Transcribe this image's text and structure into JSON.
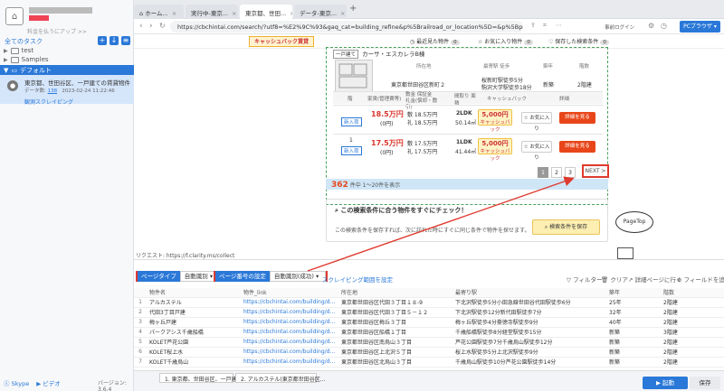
{
  "sidebar": {
    "account_sub": "料金を払うにアップ >>",
    "task_title": "全てのタスク",
    "folders": [
      {
        "label": "test"
      },
      {
        "label": "Samples"
      }
    ],
    "default_label": "デフォルト",
    "task": {
      "name": "東京都、世田谷区、一戸建ての賃貸物件（...",
      "data_label": "データ数:",
      "data_count": "138",
      "time": "2023-02-24 11:22:46",
      "link": "観測スクレイピング"
    },
    "footer": {
      "skype": "Skype",
      "video": "ビデオ",
      "version": "バージョン: 3.6.4"
    }
  },
  "browser": {
    "tabs": [
      {
        "label": "ホーム..."
      },
      {
        "label": "実行中-東京..."
      },
      {
        "label": "東京都、世田..."
      },
      {
        "label": "データ-東京..."
      }
    ],
    "url": "https://cbchintai.com/search/?utf8=%E2%9C%93&gaq_cat=building_refine&p%5Brailroad_or_location%5D=&p%5Bper_page%5D=&p%5Bsorts%5D=%5Bwith_ph",
    "login": "事前ログイン",
    "pc_button": "PCブラウザ"
  },
  "site": {
    "logo": "キャッシュバック賃貸",
    "nav": [
      {
        "label": "最近見た物件",
        "count": "0"
      },
      {
        "label": "お気に入り物件",
        "count": "0"
      },
      {
        "label": "保存した検索条件",
        "count": "0"
      }
    ],
    "building": {
      "tag": "一戸建て",
      "name": "カーサ・エスカレラB棟",
      "headers": [
        "所在地",
        "最寄駅 徒歩",
        "築年",
        "階数"
      ],
      "address": "東京都世田谷区新町２",
      "station1": "桜新町駅徒歩5分",
      "station2": "駒沢大学駅徒歩18分",
      "age": "新築",
      "floors": "2階建"
    },
    "room_headers": [
      "階",
      "家賃(管理費等)",
      "敷金 保証金\n礼金(償却・敷引)",
      "間取り 面積",
      "キャッシュバック",
      "詳細"
    ],
    "rooms": [
      {
        "floor": "",
        "tag": "新入荷",
        "rent": "18.5万円",
        "fee": "(0円)",
        "deposit": "敷 18.5万円",
        "key": "礼 18.5万円",
        "layout": "2LDK",
        "area": "50.14㎡",
        "cb": "5,000円",
        "fav": "☆ お気に入り",
        "detail": "詳細を見る"
      },
      {
        "floor": "1",
        "tag": "新入荷",
        "rent": "17.5万円",
        "fee": "(0円)",
        "deposit": "敷 17.5万円",
        "key": "礼 17.5万円",
        "layout": "1LDK",
        "area": "41.44㎡",
        "cb": "5,000円",
        "fav": "☆ お気に入り",
        "detail": "詳細を見る"
      }
    ],
    "cb_sub": "キャッシュバック",
    "pages": [
      "1",
      "2",
      "3"
    ],
    "next": "NEXT >",
    "count_num": "362",
    "count_text": "件中 1〜20件を表示",
    "save_title": "この検索条件に合う物件をすぐにチェック！",
    "save_sub": "この検索条件を保存すれば、次に訪れた時にすぐに同じ条件で物件を探せます。",
    "save_btn": "検索条件を保存",
    "pagetop": "PageTop"
  },
  "request": "リクエスト: https://f.clarity.ms/collect",
  "collapse": "折る",
  "toolbar": {
    "page_type_label": "ページタイプ",
    "page_type_value": "自動識別",
    "page_num_label": "ページ番号の設定",
    "page_num_value": "自動識別(成功)",
    "scrape_link": "スクレイピング範囲を設定",
    "filter": "フィルター",
    "clear": "クリア",
    "detail": "詳細ページに行く",
    "add_field": "フィールドを追加"
  },
  "table": {
    "headers": [
      "",
      "物件名",
      "物件_link",
      "所在地",
      "最寄り駅",
      "築年",
      "階数"
    ],
    "rows": [
      [
        "1",
        "アルカステル",
        "https://cbchintai.com/building/detail/bd0069...",
        "東京都世田谷区代田３丁目１８-9",
        "下北沢駅徒歩5分小田急線世田谷代田駅徒歩6分",
        "25年",
        "2階建"
      ],
      [
        "2",
        "代田3丁目戸建",
        "https://cbchintai.com/building/detail/bd0181...",
        "東京都世田谷区代田３丁目５－１２",
        "下北沢駅徒歩12分新代田駅徒歩7分",
        "32年",
        "2階建"
      ],
      [
        "3",
        "梅ヶ丘戸建",
        "https://cbchintai.com/building/detail/bd0081...",
        "東京都世田谷区梅丘３丁目",
        "梅ヶ丘駅徒歩4分豪徳寺駅徒歩9分",
        "40年",
        "2階建"
      ],
      [
        "4",
        "パークアシス千歳船橋",
        "https://cbchintai.com/building/detail/bd0905...",
        "東京都世田谷区船橋１丁目",
        "千歳船橋駅徒歩8分経堂駅徒歩15分",
        "新築",
        "3階建"
      ],
      [
        "5",
        "KOLET芦花公園",
        "https://cbchintai.com/building/detail/bd0905...",
        "東京都世田谷区南烏山３丁目",
        "芦花公園駅徒歩7分千歳烏山駅徒歩12分",
        "新築",
        "2階建"
      ],
      [
        "6",
        "KOLET桜上水",
        "https://cbchintai.com/building/detail/bd0906...",
        "東京都世田谷区上北沢５丁目",
        "桜上水駅徒歩5分上北沢駅徒歩9分",
        "新築",
        "2階建"
      ],
      [
        "7",
        "KOLET千歳烏山",
        "https://cbchintai.com/building/detail/bd0906...",
        "東京都世田谷区北烏山３丁目",
        "千歳烏山駅徒歩10分芦花公園駅徒歩14分",
        "新築",
        "2階建"
      ]
    ]
  },
  "footer": {
    "tab1": "1. 東京都、世田谷区、一戸建ての...",
    "tab2": "2. アルカステル(東京都世田谷区...",
    "start": "起動",
    "save": "保存"
  },
  "colors": {
    "accent": "#2a78d8",
    "highlight": "#e03a2e"
  }
}
